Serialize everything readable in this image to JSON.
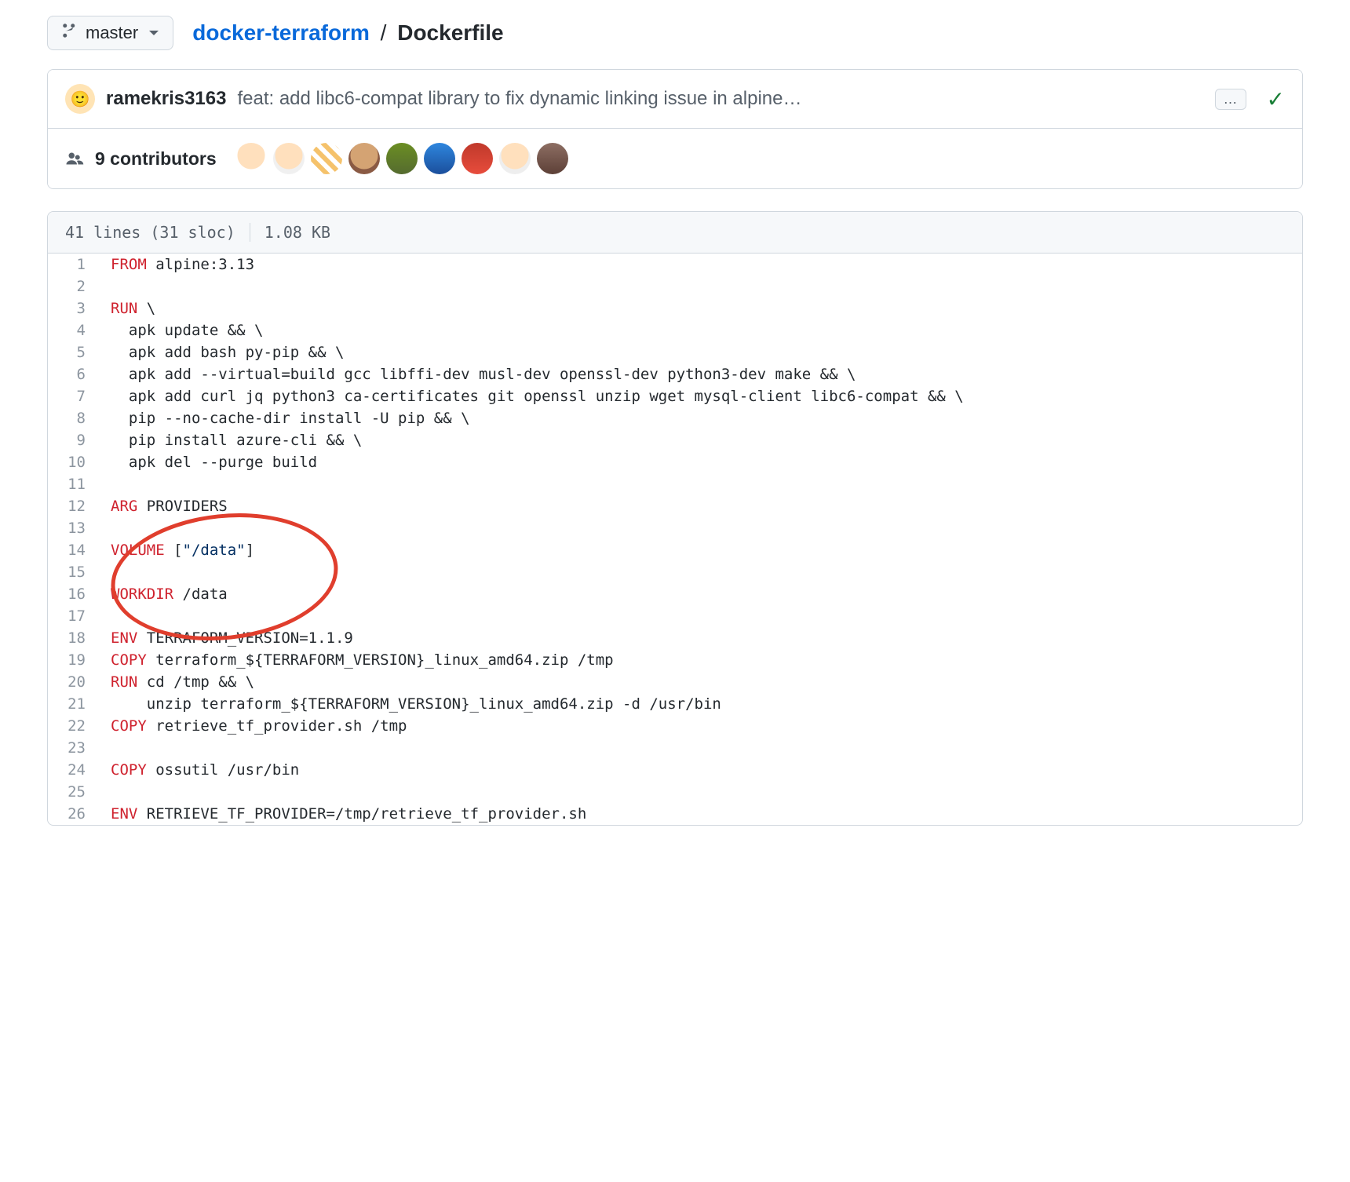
{
  "branch": {
    "label": "master"
  },
  "breadcrumb": {
    "repo": "docker-terraform",
    "sep": "/",
    "file": "Dockerfile"
  },
  "commit": {
    "author": "ramekris3163",
    "message": "feat: add libc6-compat library to fix dynamic linking issue in alpine…",
    "kebab": "…"
  },
  "contributors": {
    "count_label": "9 contributors"
  },
  "file_meta": {
    "lines": "41 lines (31 sloc)",
    "size": "1.08 KB"
  },
  "code": [
    {
      "n": 1,
      "segs": [
        [
          "kw",
          "FROM"
        ],
        [
          "",
          " alpine:3.13"
        ]
      ]
    },
    {
      "n": 2,
      "segs": [
        [
          "",
          ""
        ]
      ]
    },
    {
      "n": 3,
      "segs": [
        [
          "kw",
          "RUN"
        ],
        [
          "",
          " \\"
        ]
      ]
    },
    {
      "n": 4,
      "segs": [
        [
          "",
          "  apk update && \\"
        ]
      ]
    },
    {
      "n": 5,
      "segs": [
        [
          "",
          "  apk add bash py-pip && \\"
        ]
      ]
    },
    {
      "n": 6,
      "segs": [
        [
          "",
          "  apk add --virtual=build gcc libffi-dev musl-dev openssl-dev python3-dev make && \\"
        ]
      ]
    },
    {
      "n": 7,
      "segs": [
        [
          "",
          "  apk add curl jq python3 ca-certificates git openssl unzip wget mysql-client libc6-compat && \\"
        ]
      ]
    },
    {
      "n": 8,
      "segs": [
        [
          "",
          "  pip --no-cache-dir install -U pip && \\"
        ]
      ]
    },
    {
      "n": 9,
      "segs": [
        [
          "",
          "  pip install azure-cli && \\"
        ]
      ]
    },
    {
      "n": 10,
      "segs": [
        [
          "",
          "  apk del --purge build"
        ]
      ]
    },
    {
      "n": 11,
      "segs": [
        [
          "",
          ""
        ]
      ]
    },
    {
      "n": 12,
      "segs": [
        [
          "kw",
          "ARG"
        ],
        [
          "",
          " PROVIDERS"
        ]
      ]
    },
    {
      "n": 13,
      "segs": [
        [
          "",
          ""
        ]
      ]
    },
    {
      "n": 14,
      "segs": [
        [
          "kw",
          "VOLUME"
        ],
        [
          "",
          " ["
        ],
        [
          "str",
          "\"/data\""
        ],
        [
          "",
          "]"
        ]
      ]
    },
    {
      "n": 15,
      "segs": [
        [
          "",
          ""
        ]
      ]
    },
    {
      "n": 16,
      "segs": [
        [
          "kw",
          "WORKDIR"
        ],
        [
          "",
          " /data"
        ]
      ]
    },
    {
      "n": 17,
      "segs": [
        [
          "",
          ""
        ]
      ]
    },
    {
      "n": 18,
      "segs": [
        [
          "kw",
          "ENV"
        ],
        [
          "",
          " TERRAFORM_VERSION=1.1.9"
        ]
      ]
    },
    {
      "n": 19,
      "segs": [
        [
          "kw",
          "COPY"
        ],
        [
          "",
          " terraform_${TERRAFORM_VERSION}_linux_amd64.zip /tmp"
        ]
      ]
    },
    {
      "n": 20,
      "segs": [
        [
          "kw",
          "RUN"
        ],
        [
          "",
          " cd /tmp && \\"
        ]
      ]
    },
    {
      "n": 21,
      "segs": [
        [
          "",
          "    unzip terraform_${TERRAFORM_VERSION}_linux_amd64.zip -d /usr/bin"
        ]
      ]
    },
    {
      "n": 22,
      "segs": [
        [
          "kw",
          "COPY"
        ],
        [
          "",
          " retrieve_tf_provider.sh /tmp"
        ]
      ]
    },
    {
      "n": 23,
      "segs": [
        [
          "",
          ""
        ]
      ]
    },
    {
      "n": 24,
      "segs": [
        [
          "kw",
          "COPY"
        ],
        [
          "",
          " ossutil /usr/bin"
        ]
      ]
    },
    {
      "n": 25,
      "segs": [
        [
          "",
          ""
        ]
      ]
    },
    {
      "n": 26,
      "segs": [
        [
          "kw",
          "ENV"
        ],
        [
          "",
          " RETRIEVE_TF_PROVIDER=/tmp/retrieve_tf_provider.sh"
        ]
      ]
    }
  ]
}
